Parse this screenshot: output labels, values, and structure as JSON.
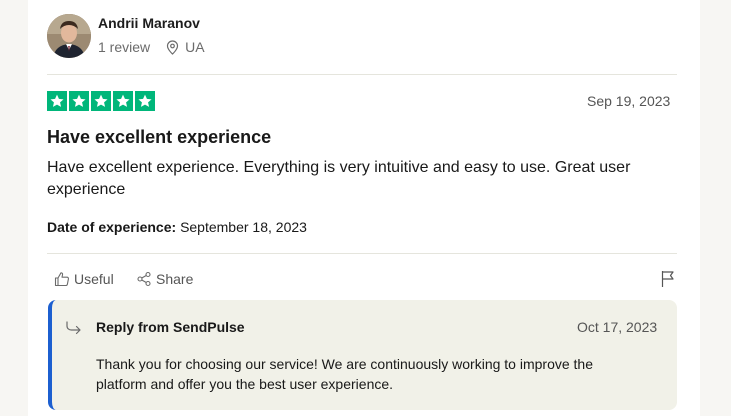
{
  "author": {
    "name": "Andrii Maranov",
    "review_count": "1 review",
    "country": "UA"
  },
  "review": {
    "rating": 5,
    "date": "Sep 19, 2023",
    "title": "Have excellent experience",
    "body": "Have excellent experience. Everything is very intuitive and easy to use. Great user experience",
    "experience_label": "Date of experience:",
    "experience_date": "September 18, 2023"
  },
  "actions": {
    "useful_label": "Useful",
    "share_label": "Share"
  },
  "reply": {
    "from": "Reply from SendPulse",
    "date": "Oct 17, 2023",
    "body": "Thank you for choosing our service! We are continuously working to improve the platform and offer you the best user experience."
  },
  "colors": {
    "star_green": "#00b67a",
    "reply_accent": "#1c5fd0",
    "reply_bg": "#f1f1e8"
  }
}
